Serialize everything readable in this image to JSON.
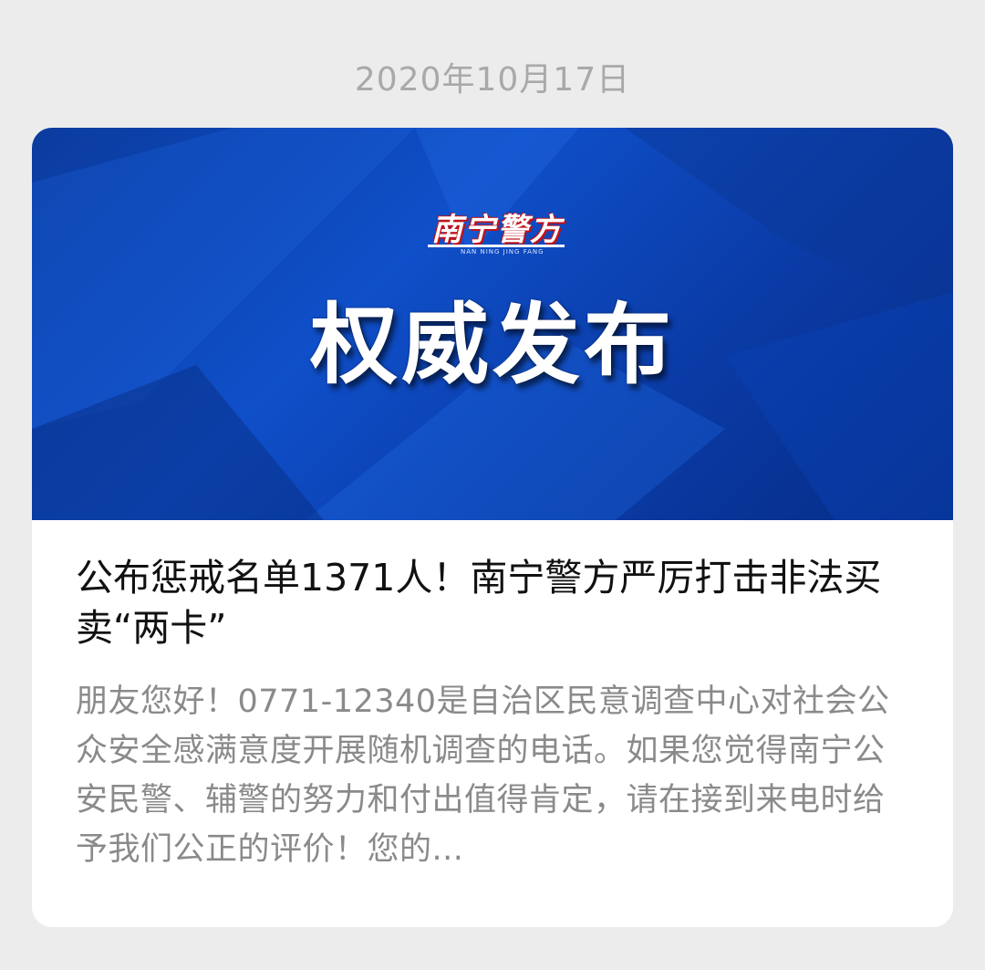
{
  "date_stamp": "2020年10月17日",
  "article_card": {
    "banner": {
      "logo_text": "南宁警方",
      "logo_subtext": "NAN NING JING FANG",
      "title": "权威发布",
      "colors": {
        "primary": "#0f4fc9",
        "dark": "#062c86",
        "accent_red": "#c0121a"
      }
    },
    "headline": "公布惩戒名单1371人！南宁警方严厉打击非法买卖“两卡”",
    "summary": "朋友您好！0771-12340是自治区民意调查中心对社会公众安全感满意度开展随机调查的电话。如果您觉得南宁公安民警、辅警的努力和付出值得肯定，请在接到来电时给予我们公正的评价！您的..."
  }
}
